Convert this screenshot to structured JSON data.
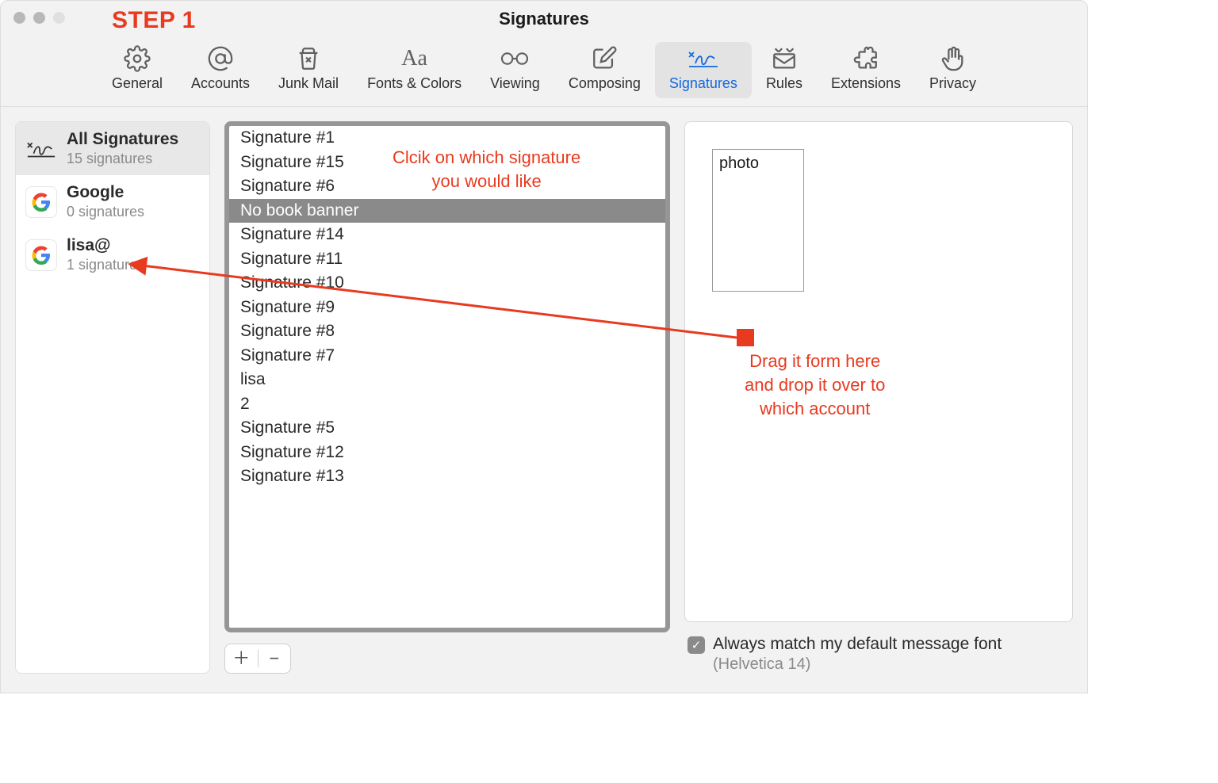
{
  "window": {
    "title": "Signatures"
  },
  "annotations": {
    "step1": "STEP 1",
    "click_line1": "Clcik on which signature",
    "click_line2": "you would like",
    "drag_line1": "Drag it form here",
    "drag_line2": "and drop it over to",
    "drag_line3": "which account"
  },
  "toolbar": {
    "tabs": [
      {
        "label": "General",
        "icon": "gear"
      },
      {
        "label": "Accounts",
        "icon": "at"
      },
      {
        "label": "Junk Mail",
        "icon": "trash"
      },
      {
        "label": "Fonts & Colors",
        "icon": "aa"
      },
      {
        "label": "Viewing",
        "icon": "glasses"
      },
      {
        "label": "Composing",
        "icon": "compose"
      },
      {
        "label": "Signatures",
        "icon": "signature",
        "active": true
      },
      {
        "label": "Rules",
        "icon": "envelope"
      },
      {
        "label": "Extensions",
        "icon": "puzzle"
      },
      {
        "label": "Privacy",
        "icon": "hand"
      }
    ]
  },
  "accounts": [
    {
      "title": "All Signatures",
      "sub": "15 signatures",
      "icon": "signature",
      "selected": true
    },
    {
      "title": "Google",
      "sub": "0 signatures",
      "icon": "google"
    },
    {
      "title": "lisa@",
      "sub": "1 signature",
      "icon": "google"
    }
  ],
  "signatures": [
    "Signature #1",
    "Signature #15",
    "Signature #6",
    "No book banner",
    "Signature #14",
    "Signature #11",
    "Signature #10",
    "Signature #9",
    "Signature #8",
    "Signature #7",
    "lisa",
    "2",
    "Signature #5",
    "Signature #12",
    "Signature #13"
  ],
  "siglist_selected_index": 3,
  "preview": {
    "photo_label": "photo"
  },
  "footer": {
    "checkbox_checked": true,
    "label": "Always match my default message font",
    "sub": "(Helvetica 14)"
  }
}
